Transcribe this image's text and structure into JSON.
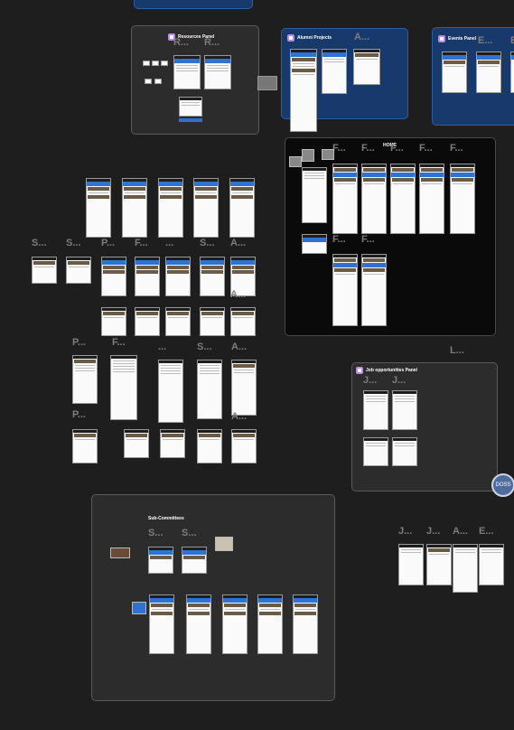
{
  "panels": {
    "resources": {
      "title": "Resources Panel",
      "labels": [
        "R...",
        "R..."
      ]
    },
    "alumni": {
      "title": "Alumni Projects",
      "labels": [
        "A..."
      ]
    },
    "events": {
      "title": "Events Panel",
      "labels": [
        "E...",
        "E...",
        "E"
      ]
    },
    "home": {
      "title": "HOME",
      "labels": [
        "F...",
        "F...",
        "F...",
        "F...",
        "F...",
        "F...",
        "F..."
      ]
    },
    "jobs": {
      "title": "Job opportunities Panel",
      "labels": [
        "J...",
        "J..."
      ]
    },
    "subcommittees": {
      "title": "Sub-Committees",
      "labels": [
        "S...",
        "S..."
      ]
    }
  },
  "loose_labels": {
    "row1": [
      "S...",
      "S...",
      "P...",
      "F...",
      "...",
      "S...",
      "A..."
    ],
    "row2_a": "A...",
    "row3": [
      "P...",
      "F...",
      "...",
      "S...",
      "A..."
    ],
    "row4": [
      "P...",
      "A..."
    ],
    "right_l": "L...",
    "bottom_right": [
      "J...",
      "J...",
      "A...",
      "E..."
    ]
  },
  "badge": "DOSS",
  "colors": {
    "canvas": "#1e1e1e",
    "panel_gray": "#2c2c2c",
    "panel_blue": "#17396c",
    "accent": "#2f72d1"
  }
}
